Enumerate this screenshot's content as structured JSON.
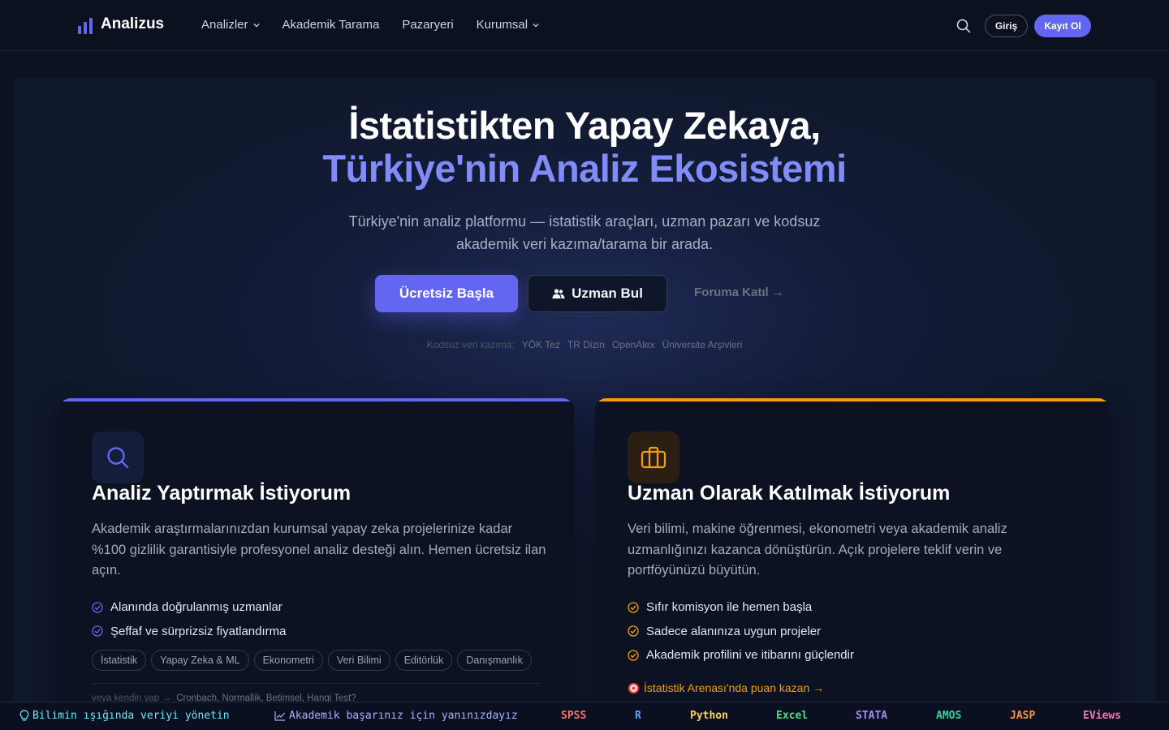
{
  "nav": {
    "logo": "Analizus",
    "links": [
      "Analizler",
      "Akademik Tarama",
      "Pazaryeri",
      "Kurumsal"
    ],
    "login": "Giriş",
    "register": "Kayıt Ol"
  },
  "hero": {
    "title_line1": "İstatistikten Yapay Zekaya,",
    "title_line2": "Türkiye'nin Analiz Ekosistemi",
    "subtitle": "Türkiye'nin analiz platformu — istatistik araçları, uzman pazarı ve kodsuz akademik veri kazıma/tarama bir arada.",
    "primary_cta": "Ücretsiz Başla",
    "secondary_cta": "Uzman Bul",
    "forum_link": "Foruma Katıl →",
    "scrape_label": "Kodsuz veri kazıma:",
    "scrape_sources": [
      "YÖK Tez",
      "TR Dizin",
      "OpenAlex",
      "Üniversite Arşivleri"
    ]
  },
  "card_client": {
    "title": "Analiz Yaptırmak İstiyorum",
    "description": "Akademik araştırmalarınızdan kurumsal yapay zeka projelerinize kadar %100 gizlilik garantisiyle profesyonel analiz desteği alın. Hemen ücretsiz ilan açın.",
    "checks": [
      "Alanında doğrulanmış uzmanlar",
      "Şeffaf ve sürprizsiz fiyatlandırma"
    ],
    "tags": [
      "İstatistik",
      "Yapay Zeka & ML",
      "Ekonometri",
      "Veri Bilimi",
      "Editörlük",
      "Danışmanlık"
    ],
    "diy_label": "veya kendin yap →",
    "diy_tests": "Cronbach, Normallik, Betimsel, Hangi Test?",
    "accent": "#6366f1"
  },
  "card_expert": {
    "title": "Uzman Olarak Katılmak İstiyorum",
    "description": "Veri bilimi, makine öğrenmesi, ekonometri veya akademik analiz uzmanlığınızı kazanca dönüştürün. Açık projelere teklif verin ve portföyünüzü büyütün.",
    "checks": [
      "Sıfır komisyon ile hemen başla",
      "Sadece alanınıza uygun projeler",
      "Akademik profilini ve itibarını güçlendir"
    ],
    "arena_link": "İstatistik Arenası'nda puan kazan →",
    "accent": "#f59e0b"
  },
  "ticker": {
    "motto1": "Bilimin ışığında veriyi yönetin",
    "motto2": "Akademik başarınız için yanınızdayız",
    "tools": [
      {
        "name": "SPSS",
        "color": "#f87171"
      },
      {
        "name": "R",
        "color": "#60a5fa"
      },
      {
        "name": "Python",
        "color": "#fcd34d"
      },
      {
        "name": "Excel",
        "color": "#4ade80"
      },
      {
        "name": "STATA",
        "color": "#a78bfa"
      },
      {
        "name": "AMOS",
        "color": "#34d399"
      },
      {
        "name": "JASP",
        "color": "#fb923c"
      },
      {
        "name": "EViews",
        "color": "#f472b6"
      }
    ]
  }
}
